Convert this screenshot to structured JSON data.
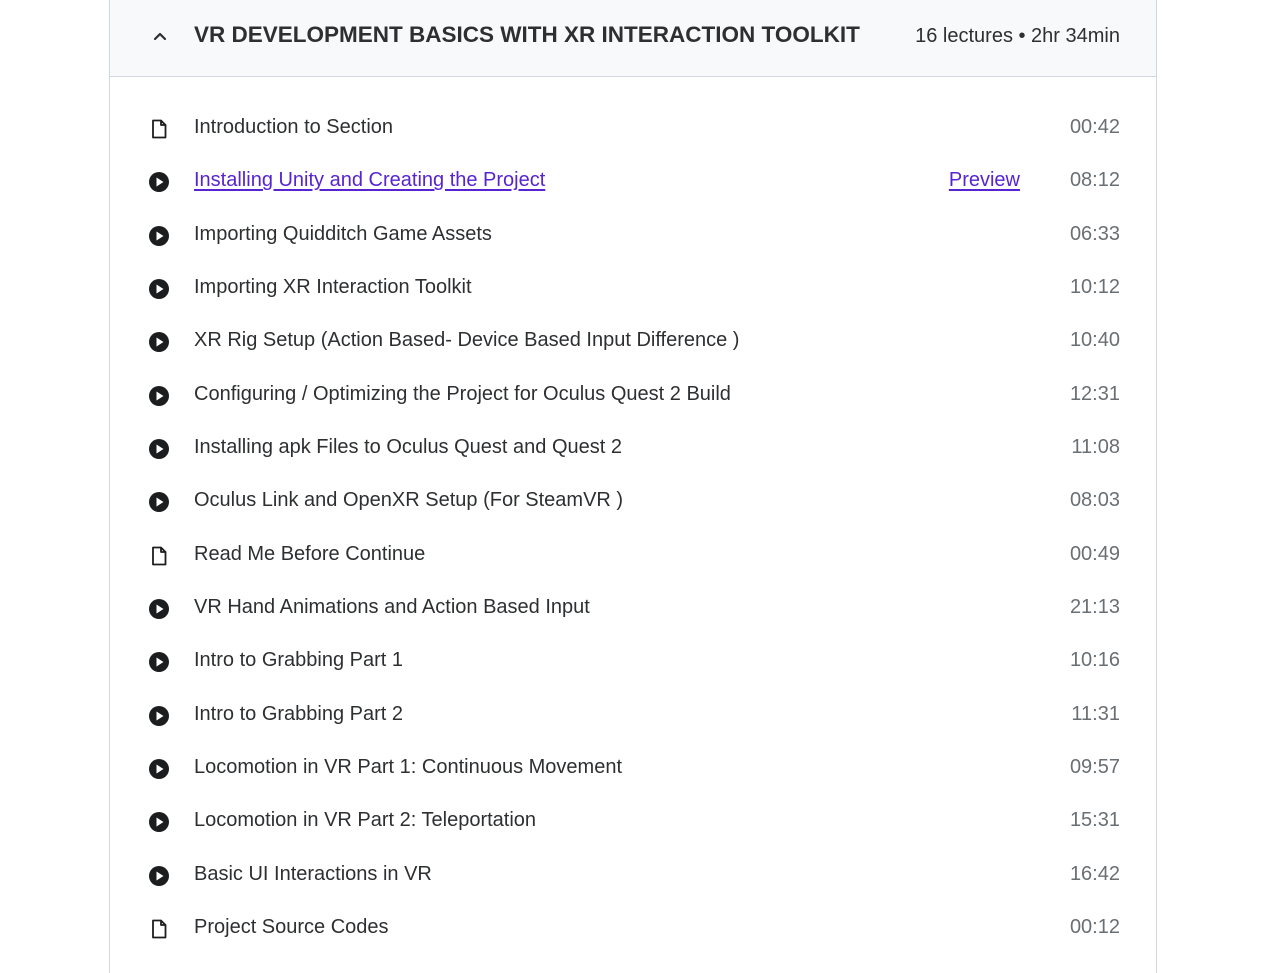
{
  "section": {
    "title": "VR DEVELOPMENT BASICS WITH XR INTERACTION TOOLKIT",
    "meta": "16 lectures • 2hr 34min",
    "expanded": true
  },
  "colors": {
    "link": "#5624d0",
    "text": "#2d2f31",
    "muted": "#6a6f73",
    "header_bg": "#f7f9fa",
    "border": "#d1d7dc"
  },
  "lectures": [
    {
      "type": "document",
      "icon": "file-icon",
      "title": "Introduction to Section",
      "duration": "00:42"
    },
    {
      "type": "video",
      "icon": "play-circle-icon",
      "title": "Installing Unity and Creating the Project",
      "duration": "08:12",
      "preview_label": "Preview"
    },
    {
      "type": "video",
      "icon": "play-circle-icon",
      "title": "Importing Quidditch Game Assets",
      "duration": "06:33"
    },
    {
      "type": "video",
      "icon": "play-circle-icon",
      "title": "Importing XR Interaction Toolkit",
      "duration": "10:12"
    },
    {
      "type": "video",
      "icon": "play-circle-icon",
      "title": "XR Rig Setup (Action Based- Device Based Input Difference )",
      "duration": "10:40"
    },
    {
      "type": "video",
      "icon": "play-circle-icon",
      "title": "Configuring / Optimizing the Project for Oculus Quest 2 Build",
      "duration": "12:31"
    },
    {
      "type": "video",
      "icon": "play-circle-icon",
      "title": "Installing apk Files to Oculus Quest and Quest 2",
      "duration": "11:08"
    },
    {
      "type": "video",
      "icon": "play-circle-icon",
      "title": "Oculus Link and OpenXR Setup (For SteamVR )",
      "duration": "08:03"
    },
    {
      "type": "document",
      "icon": "file-icon",
      "title": "Read Me Before Continue",
      "duration": "00:49"
    },
    {
      "type": "video",
      "icon": "play-circle-icon",
      "title": "VR Hand Animations and Action Based Input",
      "duration": "21:13"
    },
    {
      "type": "video",
      "icon": "play-circle-icon",
      "title": "Intro to Grabbing Part 1",
      "duration": "10:16"
    },
    {
      "type": "video",
      "icon": "play-circle-icon",
      "title": "Intro to Grabbing Part 2",
      "duration": "11:31"
    },
    {
      "type": "video",
      "icon": "play-circle-icon",
      "title": "Locomotion in VR Part 1: Continuous Movement",
      "duration": "09:57"
    },
    {
      "type": "video",
      "icon": "play-circle-icon",
      "title": "Locomotion in VR Part 2: Teleportation",
      "duration": "15:31"
    },
    {
      "type": "video",
      "icon": "play-circle-icon",
      "title": "Basic UI Interactions in VR",
      "duration": "16:42"
    },
    {
      "type": "document",
      "icon": "file-icon",
      "title": "Project Source Codes",
      "duration": "00:12"
    }
  ]
}
